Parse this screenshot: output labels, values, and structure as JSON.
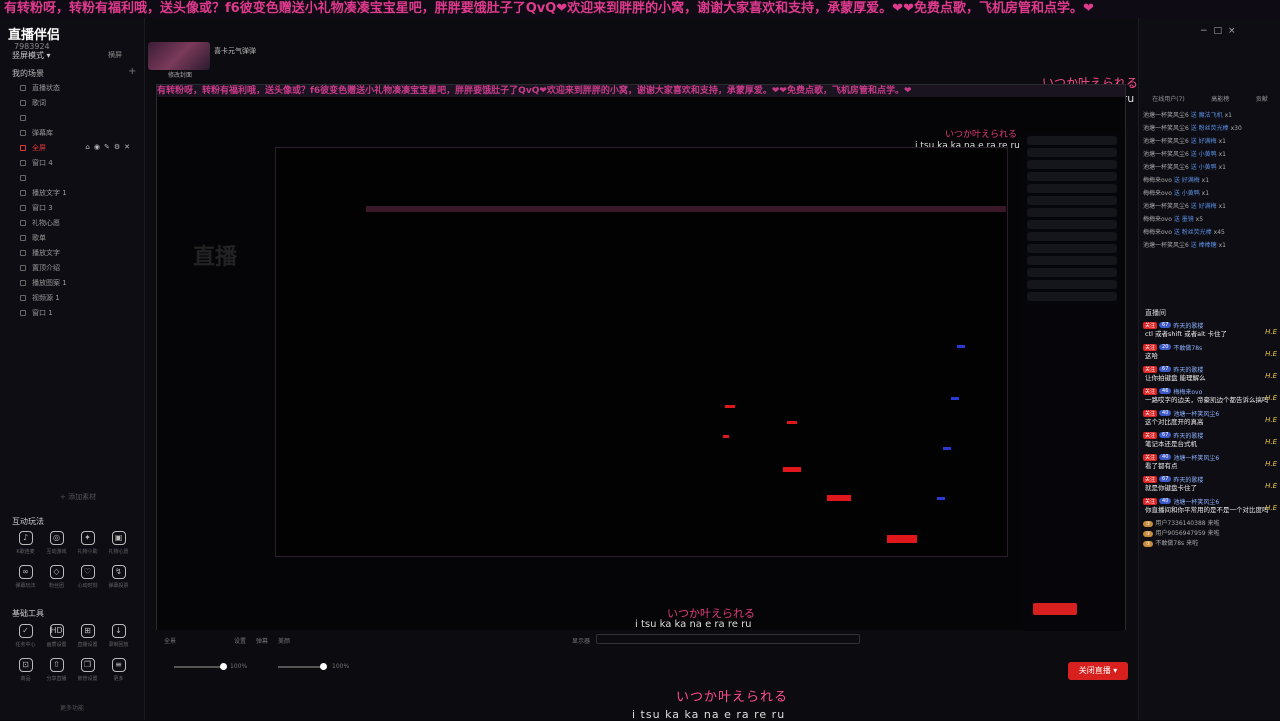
{
  "marquee": "有转粉呀，转粉有福利哦，送头像或？f6彼变色赠送小礼物凑凑宝宝星吧，胖胖要饿肚子了QvQ❤欢迎来到胖胖的小窝，谢谢大家喜欢和支持，承蒙厚爱。❤❤免费点歌，飞机房管和点学。❤",
  "app": {
    "logo": "直播伴侣",
    "user_id": "7983924",
    "mode_label": "竖屏模式 ▾",
    "mode_right": "横屏",
    "scene_title": "我的场景",
    "sources": [
      {
        "label": "直播状态",
        "active": false
      },
      {
        "label": "歌词",
        "active": false
      },
      {
        "label": "",
        "active": false
      },
      {
        "label": "弹幕库",
        "active": false
      },
      {
        "label": "全屏",
        "active": true
      },
      {
        "label": "窗口 4",
        "active": false
      },
      {
        "label": "",
        "active": false
      },
      {
        "label": "播放文字 1",
        "active": false
      },
      {
        "label": "窗口 3",
        "active": false
      },
      {
        "label": "礼物心愿",
        "active": false
      },
      {
        "label": "歌单",
        "active": false
      },
      {
        "label": "播放文字",
        "active": false
      },
      {
        "label": "置顶介绍",
        "active": false
      },
      {
        "label": "播放图案 1",
        "active": false
      },
      {
        "label": "视频源 1",
        "active": false
      },
      {
        "label": "窗口 1",
        "active": false
      }
    ],
    "add_source": "+ 添加素材",
    "interactive_title": "互动玩法",
    "interactive_tools": [
      {
        "icon": "mic-icon",
        "glyph": "♪",
        "label": "K歌连麦"
      },
      {
        "icon": "target-icon",
        "glyph": "◎",
        "label": "互动游戏"
      },
      {
        "icon": "gift-icon",
        "glyph": "✦",
        "label": "礼物小助"
      },
      {
        "icon": "box-icon",
        "glyph": "▣",
        "label": "礼物心愿"
      },
      {
        "icon": "bike-icon",
        "glyph": "∞",
        "label": "弹幕玩法"
      },
      {
        "icon": "shield-icon",
        "glyph": "◇",
        "label": "粉丝团"
      },
      {
        "icon": "heart-icon",
        "glyph": "♡",
        "label": "心动时刻"
      },
      {
        "icon": "pk-icon",
        "glyph": "↯",
        "label": "弹幕投票"
      }
    ],
    "basic_title": "基础工具",
    "basic_tools": [
      {
        "icon": "task-icon",
        "glyph": "✓",
        "label": "任务中心"
      },
      {
        "icon": "hd-icon",
        "glyph": "HD",
        "label": "画质设置"
      },
      {
        "icon": "screen-icon",
        "glyph": "⊞",
        "label": "直播设置"
      },
      {
        "icon": "download-icon",
        "glyph": "↓",
        "label": "录制回放"
      },
      {
        "icon": "bag-icon",
        "glyph": "⊡",
        "label": "商品"
      },
      {
        "icon": "upload-icon",
        "glyph": "⇧",
        "label": "分享直播"
      },
      {
        "icon": "copy-icon",
        "glyph": "❐",
        "label": "房管设置"
      },
      {
        "icon": "doc-icon",
        "glyph": "≡",
        "label": "更多"
      }
    ],
    "more_label": "更多功能",
    "top": {
      "cover_label": "修改封面",
      "stream_title": "喜卡元气弹弹"
    },
    "bottom": {
      "labels": [
        "全景",
        "设置",
        "弹幕",
        "美颜"
      ],
      "display_label": "显示器",
      "slider1_value": "100%",
      "slider2_value": "100%",
      "close_button": "关闭直播 ▾"
    }
  },
  "lyrics": {
    "japanese": "いつか叶えられる",
    "romaji": "i tsu ka ka na e ra re ru"
  },
  "right_panel": {
    "tabs": [
      "在线用户(7)",
      "高能榜",
      "贡献"
    ],
    "gifts": [
      {
        "user": "池塘一杯笑风尘6",
        "action": "送 魔法飞机",
        "count": "x1"
      },
      {
        "user": "池塘一杯笑风尘6",
        "action": "送 粉丝荧光棒",
        "count": "x30"
      },
      {
        "user": "池塘一杯笑风尘6",
        "action": "送 好满梅",
        "count": "x1"
      },
      {
        "user": "池塘一杯笑风尘6",
        "action": "送 小黄鸭",
        "count": "x1"
      },
      {
        "user": "池塘一杯笑风尘6",
        "action": "送 小黄鸭",
        "count": "x1"
      },
      {
        "user": "梅梅来ovo",
        "action": "送 好满梅",
        "count": "x1"
      },
      {
        "user": "梅梅来ovo",
        "action": "送 小黄鸭",
        "count": "x1"
      },
      {
        "user": "池塘一杯笑风尘6",
        "action": "送 好满梅",
        "count": "x1"
      },
      {
        "user": "梅梅来ovo",
        "action": "送 墨镜",
        "count": "x5"
      },
      {
        "user": "梅梅来ovo",
        "action": "送 粉丝荧光棒",
        "count": "x45"
      },
      {
        "user": "池塘一杯笑风尘6",
        "action": "送 棒棒糖",
        "count": "x1"
      }
    ],
    "chat_title": "直播间",
    "messages": [
      {
        "nick": "昨天的歌楼",
        "level": "67",
        "text": "ctl 或者shift 或者alt 卡住了"
      },
      {
        "nick": "不敢做78s",
        "level": "20",
        "text": "这哈"
      },
      {
        "nick": "昨天的歌楼",
        "level": "67",
        "text": "让你拍键盘 能理解么"
      },
      {
        "nick": "梅梅来ovo",
        "level": "46",
        "text": "一路哎字的边关，帝豪凯边个都告诉么搞吗"
      },
      {
        "nick": "池塘一杯笑风尘6",
        "level": "40",
        "text": "这个对比度开的真高"
      },
      {
        "nick": "昨天的歌楼",
        "level": "67",
        "text": "笔记本还是台式机"
      },
      {
        "nick": "池塘一杯笑风尘6",
        "level": "40",
        "text": "看了都有点"
      },
      {
        "nick": "昨天的歌楼",
        "level": "67",
        "text": "就是你键盘卡住了"
      },
      {
        "nick": "池塘一杯笑风尘6",
        "level": "40",
        "text": "你直播间和你平常用的是不是一个对比度吗"
      }
    ],
    "joins": [
      {
        "name": "用户7336140388",
        "text": "来啦"
      },
      {
        "name": "用户9056947959",
        "text": "来啦"
      },
      {
        "name": "不敢做78s",
        "text": "来啦"
      }
    ]
  }
}
